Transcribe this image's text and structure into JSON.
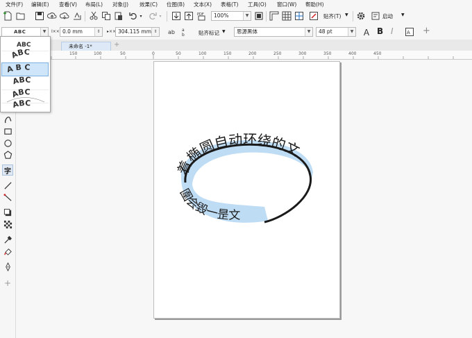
{
  "menu": [
    "文件(F)",
    "编辑(E)",
    "查看(V)",
    "布局(L)",
    "对象(J)",
    "效果(C)",
    "位图(B)",
    "文本(X)",
    "表格(T)",
    "工具(O)",
    "窗口(W)",
    "帮助(H)"
  ],
  "toolbar": {
    "zoom_value": "100%",
    "snap_label": "贴齐(T)",
    "launch_label": "启动"
  },
  "propbar": {
    "preset_value": "ABC",
    "offset_value": "0.0 mm",
    "distance_value": "304.115 mm",
    "snap_marks_label": "贴齐标记",
    "font_name": "思源黑体",
    "font_size": "48 pt",
    "bold_glyph": "B",
    "italic_glyph": "I",
    "plus_glyph": "+",
    "offset_icon_label": "Ⅰ××",
    "distance_icon_label": "▸××"
  },
  "tab": {
    "title": "未命名 -1*"
  },
  "ruler_labels": [
    "150",
    "100",
    "50",
    "0",
    "50",
    "100",
    "150",
    "200",
    "250",
    "300",
    "350",
    "400",
    "450"
  ],
  "presets": [
    "ABC",
    "ABC",
    "A B C",
    "ABC",
    "ABC",
    "ABC"
  ],
  "canvas_text": {
    "top_arc": "着椭圆自动环绕的文",
    "bottom_arc": "圍会毀一昰文"
  },
  "colors": {
    "highlight": "#bfdcf5",
    "accent": "#1e6fc7"
  }
}
